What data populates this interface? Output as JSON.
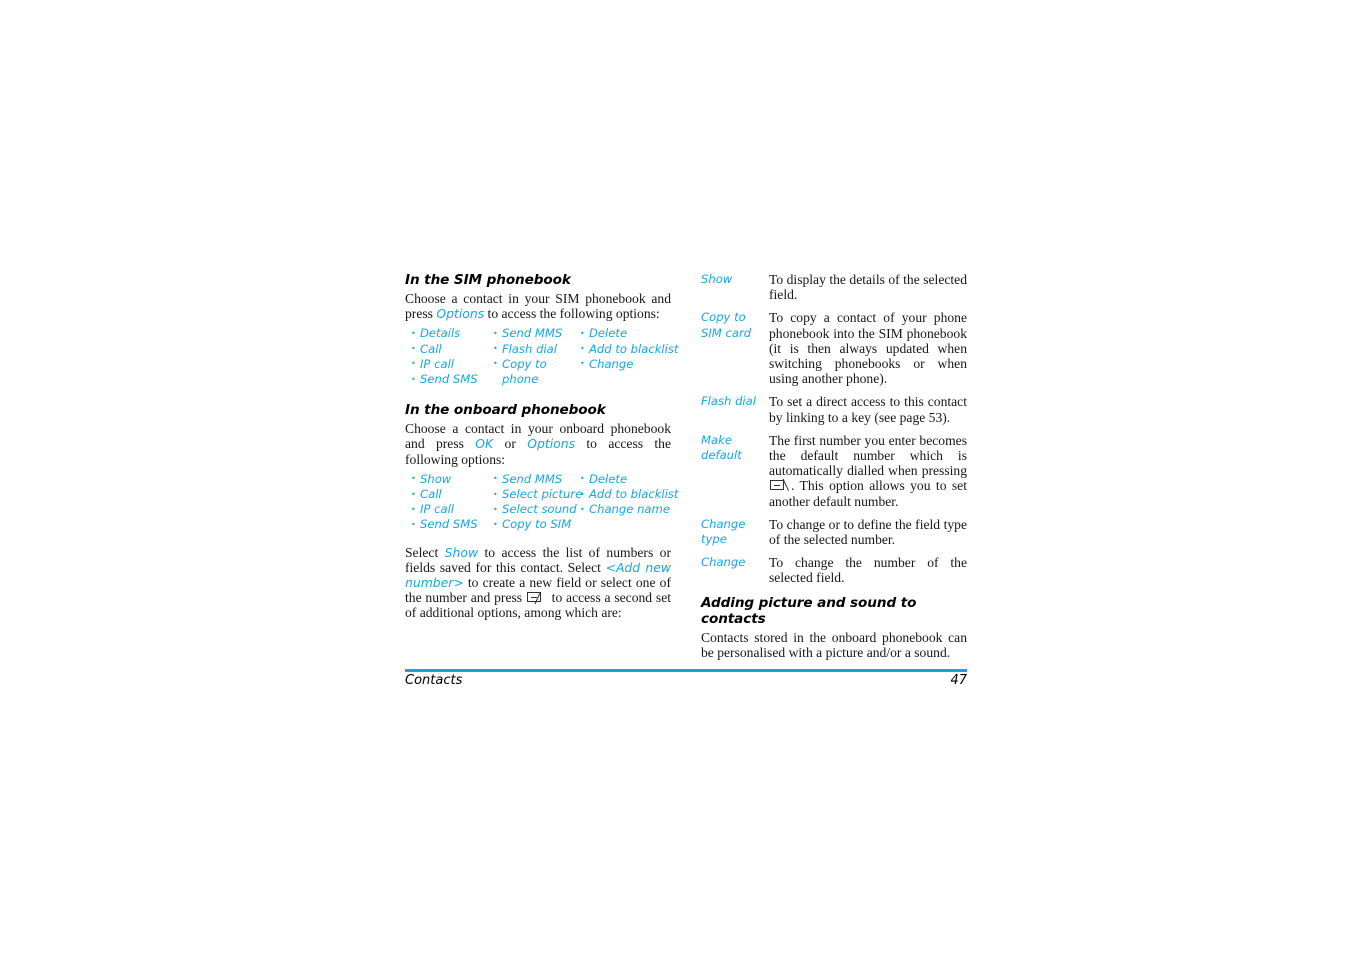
{
  "document": {
    "page_number": "47",
    "footer_title": "Contacts",
    "accent_color": "#16a7e0",
    "rule_color": "#1ba0df"
  },
  "left_column": {
    "sim_section": {
      "heading": "In the SIM phonebook",
      "intro_part1": "Choose a contact in your SIM phonebook and press ",
      "intro_keyword": "Options",
      "intro_part2": " to access the following options:",
      "options_col1": [
        "Details",
        "Call",
        "IP call",
        "Send SMS"
      ],
      "options_col2": [
        "Send MMS",
        "Flash dial",
        "Copy to"
      ],
      "options_col2_cont": "phone",
      "options_col3": [
        "Delete",
        "Add to blacklist",
        "Change"
      ]
    },
    "onboard_section": {
      "heading": "In the onboard phonebook",
      "intro_part1": "Choose a contact in your onboard phonebook and press ",
      "intro_keyword1": "OK",
      "intro_mid": " or ",
      "intro_keyword2": "Options",
      "intro_part2": " to access the following options:",
      "options_col1": [
        "Show",
        "Call",
        "IP call",
        "Send SMS"
      ],
      "options_col2": [
        "Send MMS",
        "Select picture",
        "Select sound",
        "Copy to SIM"
      ],
      "options_col3": [
        "Delete",
        "Add to blacklist",
        "Change name"
      ]
    },
    "closing_paragraph": {
      "part1": "Select ",
      "keyword1": "Show",
      "part2": " to access the list of numbers or fields saved for this contact. Select ",
      "keyword2": "<Add new number>",
      "part3": " to create a new field or select one of the number and press ",
      "icon": "call-key-icon",
      "part4": " to access a second set of additional options, among which are:"
    }
  },
  "right_column": {
    "definitions": [
      {
        "term": "Show",
        "description": "To display the details of the selected field."
      },
      {
        "term": "Copy to SIM card",
        "description": "To copy a contact of your phone phonebook into the SIM phonebook (it is then always updated when switching phonebooks or when using another phone)."
      },
      {
        "term": "Flash dial",
        "description": "To set a direct access to this contact by linking to a key (see page 53)."
      },
      {
        "term": "Make default",
        "description_part1": "The first number you enter becomes the default number which is automatically dialled when pressing ",
        "icon": "hangup-key-icon",
        "description_part2": ". This option allows you to set another default number."
      },
      {
        "term": "Change type",
        "description": "To change or to define the field type of the selected number."
      },
      {
        "term": "Change",
        "description": "To change the number of the selected field."
      }
    ],
    "picture_sound_section": {
      "heading": "Adding picture and sound to contacts",
      "paragraph": "Contacts stored in the onboard phonebook can be personalised with a picture and/or a sound."
    }
  }
}
